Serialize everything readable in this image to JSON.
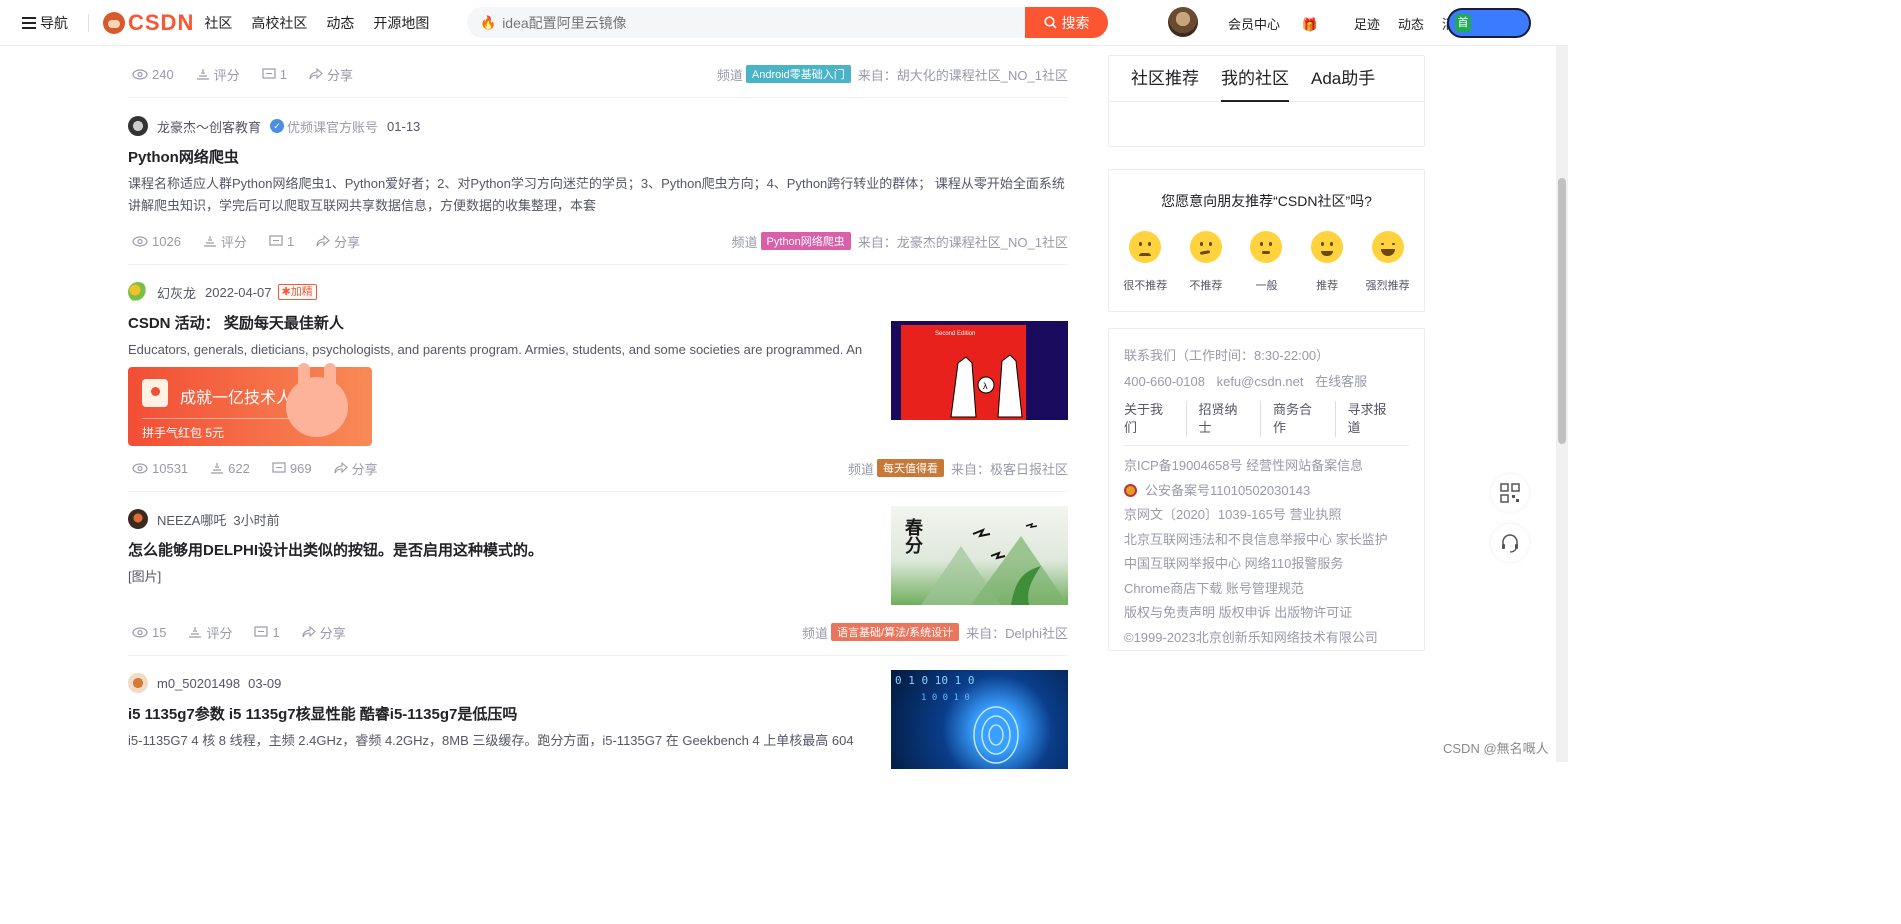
{
  "topbar": {
    "nav_label": "导航",
    "logo_text": "CSDN",
    "nav_links": [
      "社区",
      "高校社区",
      "动态",
      "开源地图"
    ],
    "search_placeholder": "idea配置阿里云镜像",
    "search_button": "搜索",
    "right_links": [
      "会员中心",
      "足迹",
      "动态",
      "消息"
    ],
    "create_badge": "首"
  },
  "feed": {
    "top_stats": {
      "views": "240",
      "rate": "评分",
      "comments": "1",
      "share": "分享",
      "channel_label": "频道",
      "channel_tag": "Android零基础入门",
      "channel_color": "#49b3c8",
      "source": "来自：胡大化的课程社区_NO_1社区"
    },
    "articles": [
      {
        "author": "龙豪杰～创客教育",
        "verified_label": "优频课官方账号",
        "date": "01-13",
        "title": "Python网络爬虫",
        "desc": "课程名称适应人群Python网络爬虫1、Python爱好者；2、对Python学习方向迷茫的学员；3、Python爬虫方向；4、Python跨行转业的群体； 课程从零开始全面系统讲解爬虫知识，学完后可以爬取互联网共享数据信息，方便数据的收集整理，本套",
        "views": "1026",
        "rate": "评分",
        "comments": "1",
        "share": "分享",
        "channel_label": "频道",
        "channel_tag": "Python网络爬虫",
        "channel_color": "#d85fa8",
        "source": "来自：龙豪杰的课程社区_NO_1社区"
      },
      {
        "author": "幻灰龙",
        "date": "2022-04-07",
        "badge": "加精",
        "title": "CSDN 活动： 奖励每天最佳新人",
        "desc": "Educators, generals, dieticians, psychologists, and parents program. Armies, students, and some societies are programmed. An",
        "redpack_title": "成就一亿技术人!",
        "redpack_sub": "拼手气红包 5元",
        "thumb_caption": "Second Edition",
        "views": "10531",
        "rate": "622",
        "comments": "969",
        "share": "分享",
        "channel_label": "频道",
        "channel_tag": "每天值得看",
        "channel_color": "#c7793a",
        "source": "来自：极客日报社区"
      },
      {
        "author": "NEEZA哪吒",
        "date": "3小时前",
        "title": "怎么能够用DELPHI设计出类似的按钮。是否启用这种模式的。",
        "desc": "[图片]",
        "thumb_caption": "春分",
        "views": "15",
        "rate": "评分",
        "comments": "1",
        "share": "分享",
        "channel_label": "频道",
        "channel_tag": "语言基础/算法/系统设计",
        "channel_color": "#e9765c",
        "source": "来自：Delphi社区"
      },
      {
        "author": "m0_50201498",
        "date": "03-09",
        "title": "i5 1135g7参数 i5 1135g7核显性能 酷睿i5-1135g7是低压吗",
        "desc": "i5-1135G7 4 核 8 线程，主频 2.4GHz，睿频 4.2GHz，8MB 三级缓存。跑分方面，i5-1135G7 在 Geekbench 4 上单核最高 604"
      }
    ]
  },
  "sidebar": {
    "tabs": [
      "社区推荐",
      "我的社区",
      "Ada助手"
    ],
    "recommend_question": "您愿意向朋友推荐“CSDN社区”吗?",
    "faces": [
      "很不推荐",
      "不推荐",
      "一般",
      "推荐",
      "强烈推荐"
    ],
    "contact_title": "联系我们（工作时间：8:30-22:00）",
    "phone": "400-660-0108",
    "email": "kefu@csdn.net",
    "online": "在线客服",
    "links": [
      "关于我们",
      "招贤纳士",
      "商务合作",
      "寻求报道"
    ],
    "licenses": [
      "京ICP备19004658号  经营性网站备案信息",
      "公安备案号11010502030143",
      "京网文〔2020〕1039-165号  营业执照",
      "北京互联网违法和不良信息举报中心  家长监护",
      "中国互联网举报中心  网络110报警服务",
      "Chrome商店下载  账号管理规范",
      "版权与免责声明  版权申诉  出版物许可证",
      "©1999-2023北京创新乐知网络技术有限公司"
    ]
  },
  "watermark": "CSDN @無名嘅人"
}
